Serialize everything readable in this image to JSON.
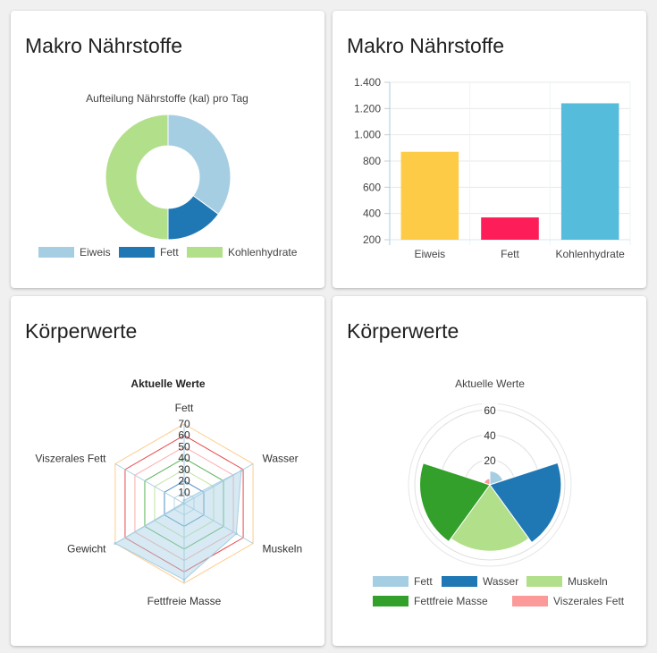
{
  "cards": {
    "macro_donut": {
      "title": "Makro Nährstoffe"
    },
    "macro_bar": {
      "title": "Makro Nährstoffe"
    },
    "body_radar": {
      "title": "Körperwerte"
    },
    "body_polar": {
      "title": "Körperwerte"
    }
  },
  "chart_data": [
    {
      "type": "pie",
      "variant": "doughnut",
      "title": "Aufteilung Nährstoffe (kal) pro Tag",
      "categories": [
        "Eiweis",
        "Fett",
        "Kohlenhydrate"
      ],
      "values": [
        870,
        370,
        1240
      ],
      "colors": [
        "#a6cee3",
        "#1f78b4",
        "#b2df8a"
      ],
      "legend": "bottom"
    },
    {
      "type": "bar",
      "title": "",
      "categories": [
        "Eiweis",
        "Fett",
        "Kohlenhydrate"
      ],
      "values": [
        870,
        370,
        1240
      ],
      "colors": [
        "#fdcb46",
        "#fd1d58",
        "#55bcdc"
      ],
      "ylim": [
        200,
        1400
      ],
      "yticks": [
        "200",
        "400",
        "600",
        "800",
        "1.000",
        "1.200",
        "1.400"
      ],
      "grid": true
    },
    {
      "type": "radar",
      "title": "Aktuelle Werte",
      "categories": [
        "Fett",
        "Wasser",
        "Muskeln",
        "Fettfreie Masse",
        "Gewicht",
        "Viszerales Fett"
      ],
      "values": [
        3,
        58,
        53,
        67,
        70,
        1
      ],
      "range": [
        0,
        70
      ],
      "ticks": [
        "10",
        "20",
        "30",
        "40",
        "50",
        "60",
        "70"
      ],
      "fill": "#a6cee3"
    },
    {
      "type": "polarArea",
      "title": "Aktuelle Werte",
      "categories": [
        "Fett",
        "Wasser",
        "Muskeln",
        "Fettfreie Masse",
        "Viszerales Fett"
      ],
      "values": [
        11,
        57,
        53,
        56,
        5
      ],
      "colors": [
        "#a6cee3",
        "#1f78b4",
        "#b2df8a",
        "#33a02c",
        "#fb9a99"
      ],
      "range": [
        0,
        65
      ],
      "ticks": [
        "20",
        "40",
        "60"
      ],
      "legend": "bottom"
    }
  ]
}
